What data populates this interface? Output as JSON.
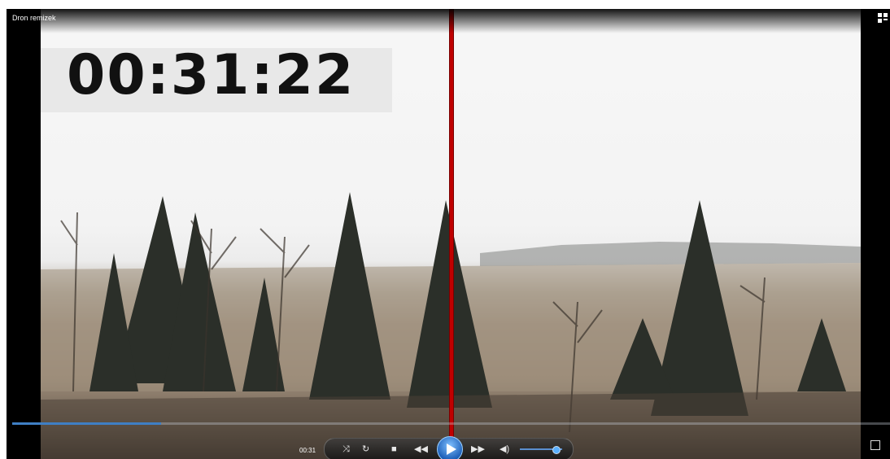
{
  "window": {
    "title": "Dron remizek"
  },
  "video": {
    "timestamp_overlay": "00:31:22"
  },
  "seek": {
    "progress": 0.17
  },
  "controls": {
    "elapsed": "00:31",
    "shuffle_icon": "shuffle-icon",
    "repeat_icon": "repeat-icon",
    "stop_icon": "stop-icon",
    "rewind_icon": "rewind-icon",
    "play_icon": "play-icon",
    "forward_icon": "fast-forward-icon",
    "volume_icon": "speaker-icon",
    "volume_level": 0.85
  },
  "colors": {
    "accent": "#3f7fc4",
    "divider": "#bf0000"
  }
}
